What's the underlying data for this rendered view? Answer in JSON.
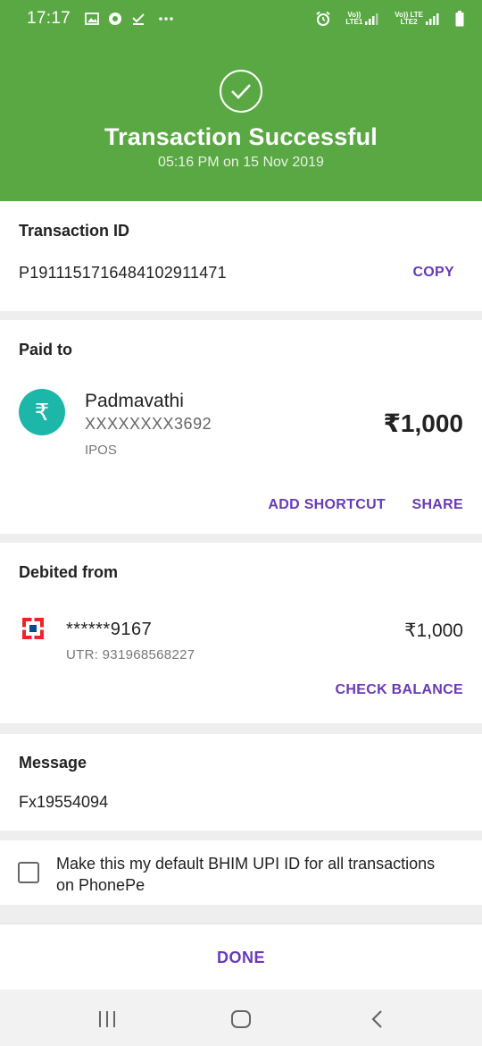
{
  "status_bar": {
    "time": "17:17",
    "left_icons": [
      "image-icon",
      "chrome-icon",
      "download-done-icon",
      "more-dots-icon"
    ],
    "right_icons": [
      "alarm-icon",
      "sim1-signal-icon",
      "sim2-signal-icon",
      "battery-icon"
    ],
    "sim1_label_top": "Vo))",
    "sim1_label_bottom": "LTE1",
    "sim2_label_top": "Vo))  LTE",
    "sim2_label_bottom": "LTE2"
  },
  "header": {
    "title": "Transaction Successful",
    "subtitle": "05:16 PM on 15 Nov 2019",
    "bg_color": "#5aa844"
  },
  "transaction": {
    "label": "Transaction ID",
    "id": "P1911151716484102911471",
    "copy_label": "COPY"
  },
  "paid_to": {
    "label": "Paid to",
    "avatar_symbol": "₹",
    "name": "Padmavathi",
    "account": "XXXXXXXX3692",
    "tag": "IPOS",
    "amount": "₹1,000",
    "add_shortcut_label": "ADD SHORTCUT",
    "share_label": "SHARE"
  },
  "debited_from": {
    "label": "Debited from",
    "account": "******9167",
    "utr": "UTR: 931968568227",
    "amount": "₹1,000",
    "check_balance_label": "CHECK BALANCE"
  },
  "message": {
    "label": "Message",
    "value": "Fx19554094"
  },
  "default_upi": {
    "checked": false,
    "label": "Make this my default BHIM UPI ID for all transactions on PhonePe"
  },
  "footer": {
    "done_label": "DONE"
  },
  "colors": {
    "accent": "#673ab7",
    "success_green": "#5aa844",
    "avatar_teal": "#1cb7a9"
  }
}
